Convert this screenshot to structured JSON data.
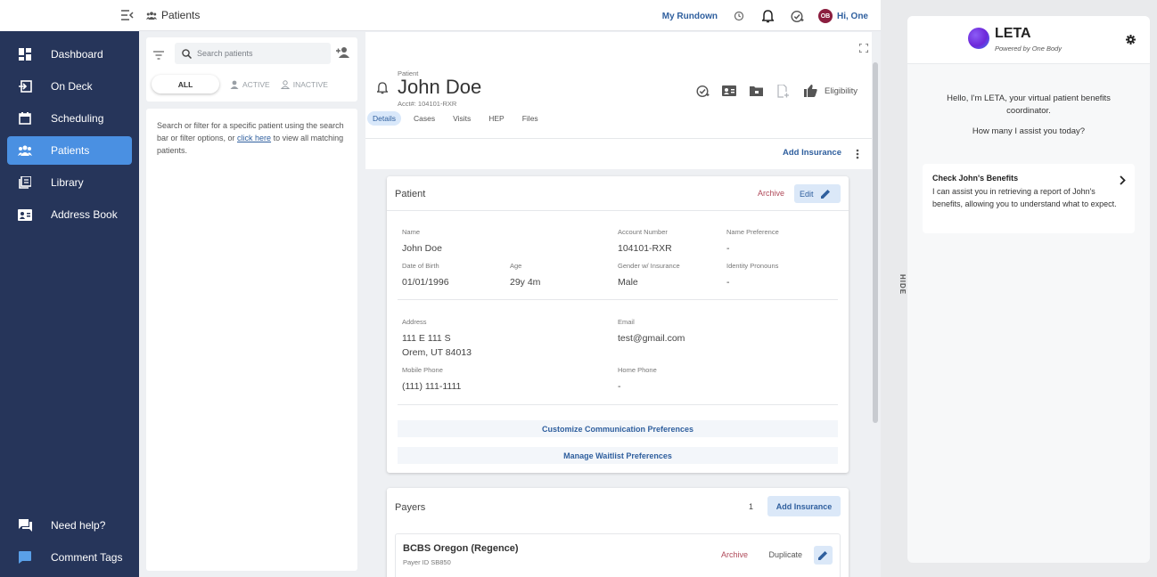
{
  "sidebar": {
    "items": [
      {
        "label": "Dashboard",
        "icon": "dashboard-icon"
      },
      {
        "label": "On Deck",
        "icon": "on-deck-icon"
      },
      {
        "label": "Scheduling",
        "icon": "calendar-icon"
      },
      {
        "label": "Patients",
        "icon": "patients-icon",
        "active": true
      },
      {
        "label": "Library",
        "icon": "library-icon"
      },
      {
        "label": "Address Book",
        "icon": "address-book-icon"
      }
    ],
    "bottom": [
      {
        "label": "Need help?",
        "icon": "help-chat-icon"
      },
      {
        "label": "Comment Tags",
        "icon": "comment-icon"
      }
    ]
  },
  "header": {
    "breadcrumb": "Patients",
    "rundown": "My Rundown",
    "avatar_initials": "OB",
    "greeting": "Hi, One"
  },
  "search": {
    "placeholder": "Search patients",
    "filters": [
      "ALL",
      "ACTIVE",
      "INACTIVE"
    ],
    "help_before": "Search or filter for a specific patient using the search bar or filter options, or ",
    "help_link": "click here",
    "help_after": " to view all matching patients."
  },
  "patient_header": {
    "label": "Patient",
    "name": "John Doe",
    "acct": "Acct#: 104101-RXR",
    "eligibility": "Eligibility",
    "tabs": [
      "Details",
      "Cases",
      "Visits",
      "HEP",
      "Files"
    ],
    "add_insurance": "Add Insurance"
  },
  "patient_card": {
    "title": "Patient",
    "archive": "Archive",
    "edit": "Edit",
    "fields": {
      "name": {
        "label": "Name",
        "value": "John Doe"
      },
      "account": {
        "label": "Account Number",
        "value": "104101-RXR"
      },
      "name_pref": {
        "label": "Name Preference",
        "value": "-"
      },
      "dob": {
        "label": "Date of Birth",
        "value": "01/01/1996"
      },
      "age": {
        "label": "Age",
        "value": "29y 4m"
      },
      "gender": {
        "label": "Gender w/ Insurance",
        "value": "Male"
      },
      "pronouns": {
        "label": "Identity Pronouns",
        "value": "-"
      },
      "address": {
        "label": "Address",
        "line1": "111 E 111 S",
        "line2": "Orem, UT 84013"
      },
      "email": {
        "label": "Email",
        "value": "test@gmail.com"
      },
      "mobile": {
        "label": "Mobile Phone",
        "value": "(111) 111-1111"
      },
      "home": {
        "label": "Home Phone",
        "value": "-"
      }
    },
    "comm_prefs": "Customize Communication Preferences",
    "waitlist_prefs": "Manage Waitlist Preferences"
  },
  "payers": {
    "title": "Payers",
    "count": "1",
    "add_button": "Add Insurance",
    "items": [
      {
        "name": "BCBS Oregon (Regence)",
        "payer_id": "Payer ID SB850",
        "archive": "Archive",
        "duplicate": "Duplicate"
      }
    ]
  },
  "leta": {
    "hide": "HIDE",
    "title": "LETA",
    "subtitle": "Powered by One Body",
    "greeting": "Hello, I'm LETA, your virtual patient benefits coordinator.",
    "prompt": "How many I assist you today?",
    "card_title": "Check John's Benefits",
    "card_text": "I can assist you in retrieving a report of John's benefits, allowing you to understand what to expect."
  },
  "colors": {
    "sidebar": "#26355a",
    "active_nav": "#4a90e2",
    "link": "#2f5f9e",
    "archive": "#b04a5a"
  }
}
